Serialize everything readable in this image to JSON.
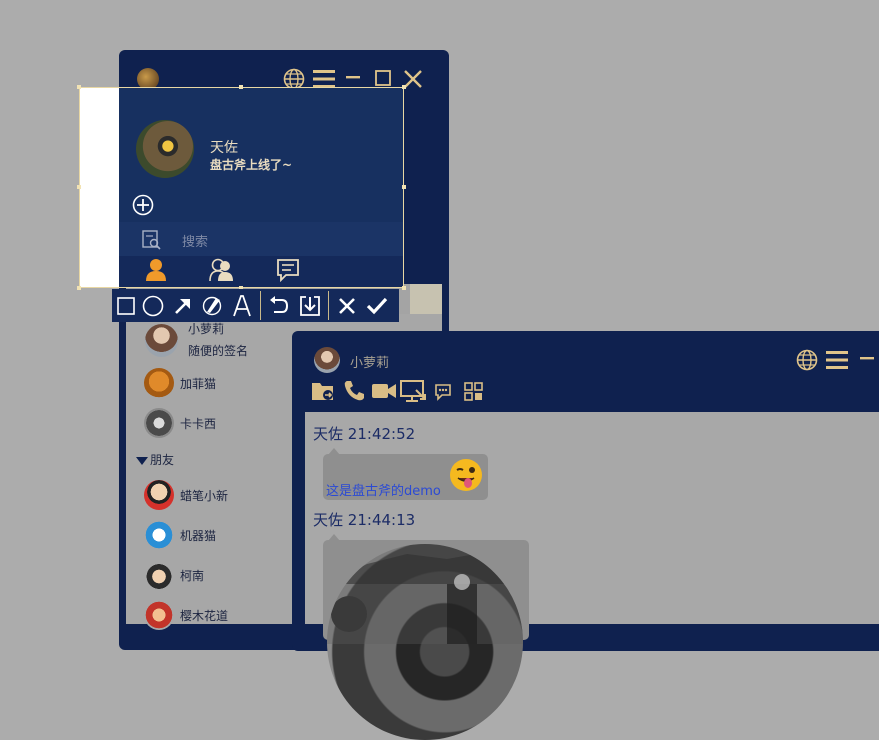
{
  "main_window": {
    "profile": {
      "name": "天佐",
      "status": "盘古斧上线了~"
    },
    "search": {
      "placeholder": "搜索"
    },
    "contacts_top": [
      {
        "name": "小萝莉",
        "signature": "随便的签名"
      },
      {
        "name": "加菲猫"
      },
      {
        "name": "卡卡西"
      }
    ],
    "friends_group": {
      "label": "朋友",
      "contacts": [
        {
          "name": "蜡笔小新"
        },
        {
          "name": "机器猫"
        },
        {
          "name": "柯南"
        },
        {
          "name": "樱木花道"
        }
      ]
    }
  },
  "chat_window": {
    "contact_name": "小萝莉",
    "messages": [
      {
        "sender": "天佐",
        "time": "21:42:52",
        "text": "这是盘古斧的demo"
      },
      {
        "sender": "天佐",
        "time": "21:44:13",
        "text": ""
      }
    ]
  },
  "colors": {
    "navy": "#0f214f",
    "gold": "#e0c48a",
    "backdrop": "#acacac",
    "link_blue": "#2b4ad4"
  },
  "icons": {
    "title_bar": [
      "globe-icon",
      "menu-icon",
      "minimize-icon",
      "maximize-icon",
      "close-icon"
    ],
    "annotation_toolbar": [
      "rectangle-icon",
      "ellipse-icon",
      "arrow-icon",
      "brush-icon",
      "text-icon",
      "undo-icon",
      "download-icon",
      "cancel-icon",
      "confirm-icon"
    ],
    "chat_toolbar": [
      "file-transfer-icon",
      "phone-icon",
      "video-icon",
      "screen-share-icon",
      "chat-settings-icon",
      "apps-icon"
    ],
    "tabs": [
      "contact-icon",
      "group-icon",
      "message-icon"
    ]
  }
}
